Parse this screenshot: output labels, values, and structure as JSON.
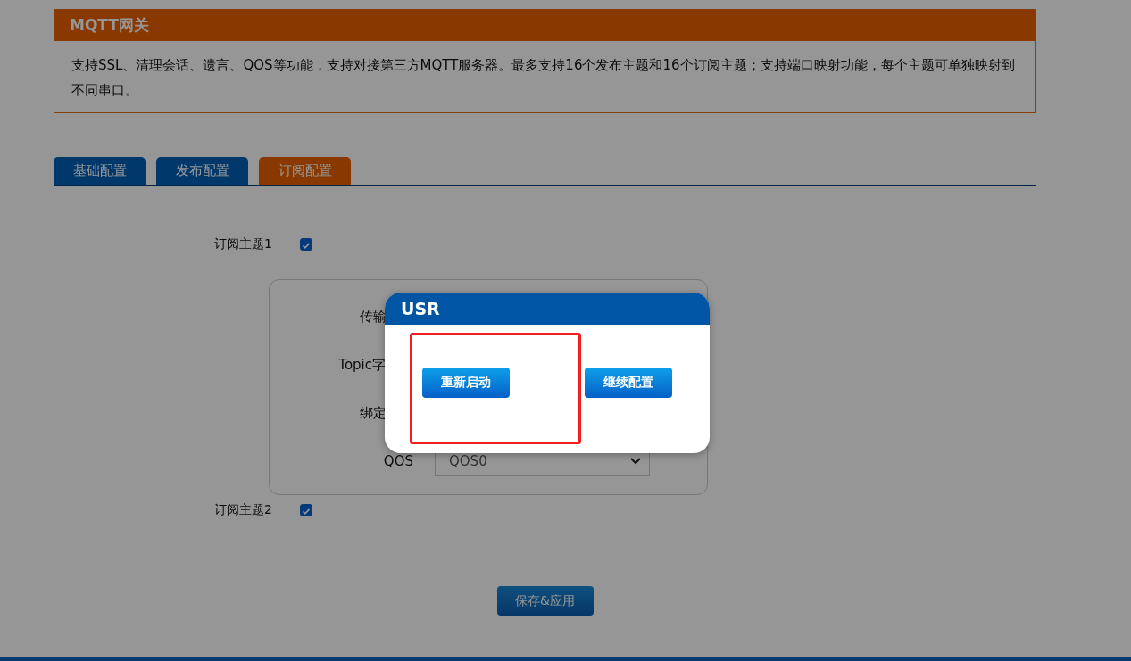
{
  "header": {
    "title": "MQTT网关",
    "description": "支持SSL、清理会话、遗言、QOS等功能，支持对接第三方MQTT服务器。最多支持16个发布主题和16个订阅主题；支持端口映射功能，每个主题可单独映射到不同串口。"
  },
  "tabs": [
    {
      "label": "基础配置",
      "selected": false
    },
    {
      "label": "发布配置",
      "selected": false
    },
    {
      "label": "订阅配置",
      "selected": true
    }
  ],
  "topics": [
    {
      "label": "订阅主题1",
      "checked": true,
      "fields": [
        {
          "label": "传输",
          "kind": "covered"
        },
        {
          "label": "Topic字",
          "kind": "covered"
        },
        {
          "label": "绑定",
          "kind": "covered"
        },
        {
          "label": "QOS",
          "kind": "select",
          "value": "QOS0"
        }
      ]
    },
    {
      "label": "订阅主题2",
      "checked": true
    }
  ],
  "save_button": "保存&应用",
  "dialog": {
    "title": "USR",
    "buttons": [
      "重新启动",
      "继续配置"
    ]
  }
}
